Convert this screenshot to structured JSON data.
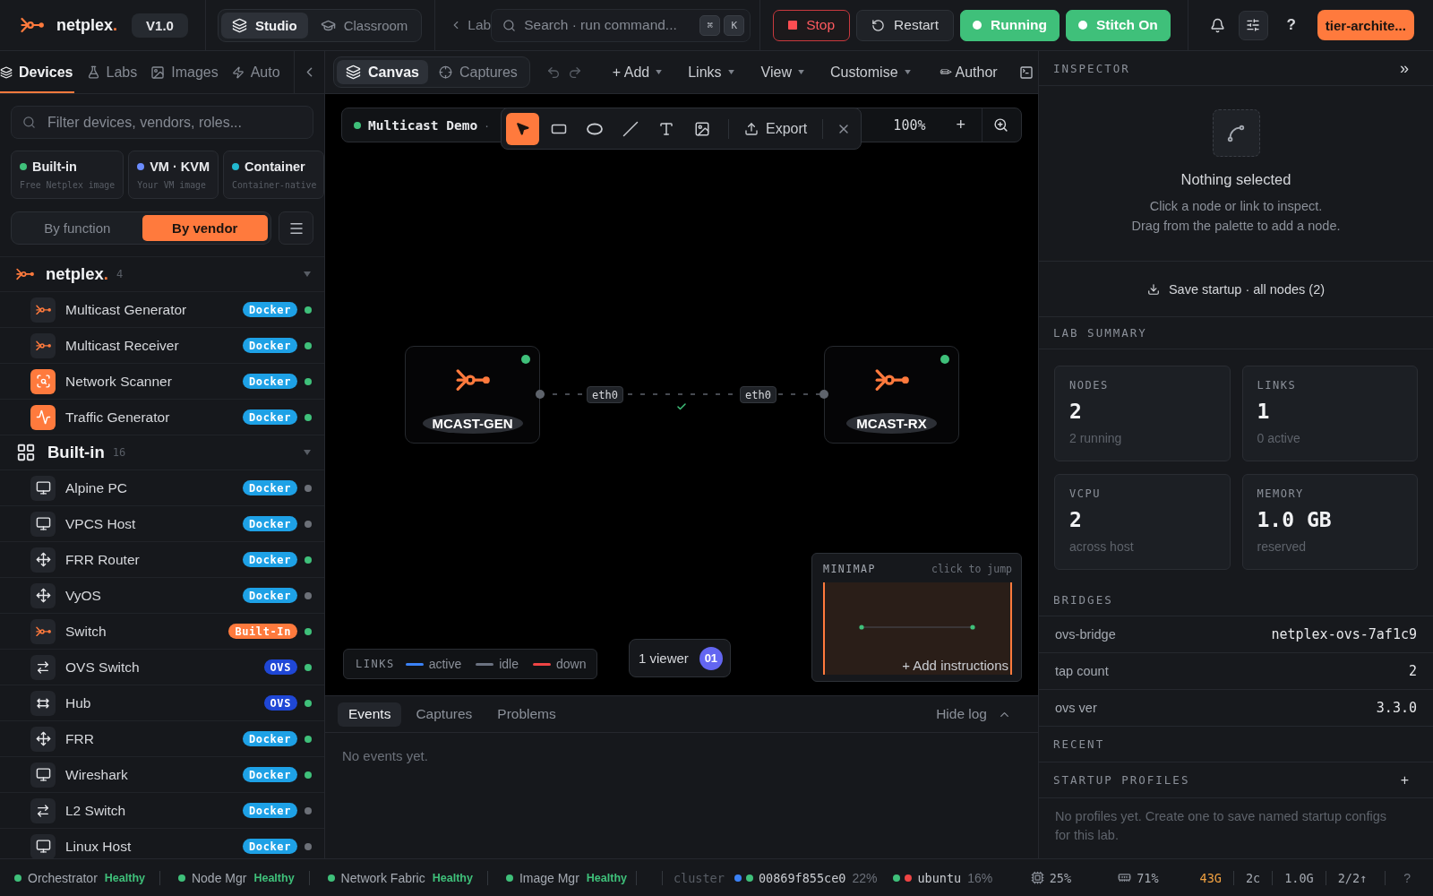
{
  "header": {
    "brand": "netplex.",
    "version": "V1.0",
    "modes": [
      {
        "label": "Studio",
        "kind": "studio",
        "selected": true
      },
      {
        "label": "Classroom",
        "kind": "classroom",
        "selected": false
      }
    ],
    "lab_tab": "Lab",
    "search": {
      "placeholder": "Search · run command...",
      "keys": [
        "⌘",
        "K"
      ]
    },
    "actions": [
      {
        "label": "Stop",
        "kind": "stop"
      },
      {
        "label": "Restart",
        "kind": "restart"
      },
      {
        "label": "Running",
        "kind": "status"
      },
      {
        "label": "Stitch On",
        "kind": "status"
      }
    ],
    "help": "?",
    "user": "tier-archite..."
  },
  "sidebar": {
    "tabs": [
      {
        "label": "Devices",
        "kind": "devices",
        "selected": true
      },
      {
        "label": "Labs",
        "kind": "labs",
        "selected": false
      },
      {
        "label": "Images",
        "kind": "images",
        "selected": false
      },
      {
        "label": "Auto",
        "kind": "auto",
        "selected": false
      }
    ],
    "filter": {
      "placeholder": "Filter devices, vendors, roles..."
    },
    "sources": [
      {
        "title": "Built-in",
        "subtitle": "Free Netplex image",
        "color": "#3fc07a"
      },
      {
        "title": "VM · KVM",
        "subtitle": "Your VM image",
        "color": "#6b8cff"
      },
      {
        "title": "Container",
        "subtitle": "Container-native",
        "color": "#22b8cf"
      }
    ],
    "grouping": [
      {
        "label": "By function",
        "selected": false
      },
      {
        "label": "By vendor",
        "selected": true
      }
    ],
    "groups": [
      {
        "name": "netplex.",
        "kind": "brand",
        "count": "4",
        "expanded": true,
        "items": [
          {
            "name": "Multicast Generator",
            "kind": "multicast",
            "badge": {
              "label": "Docker",
              "color": "#1ea1e6"
            },
            "running": true
          },
          {
            "name": "Multicast Receiver",
            "kind": "multicast",
            "badge": {
              "label": "Docker",
              "color": "#1ea1e6"
            },
            "running": true
          },
          {
            "name": "Network Scanner",
            "kind": "scanner",
            "badge": {
              "label": "Docker",
              "color": "#1ea1e6"
            },
            "running": true
          },
          {
            "name": "Traffic Generator",
            "kind": "traffic",
            "badge": {
              "label": "Docker",
              "color": "#1ea1e6"
            },
            "running": true
          }
        ]
      },
      {
        "name": "Built-in",
        "kind": "catalog",
        "count": "16",
        "expanded": true,
        "items": [
          {
            "name": "Alpine PC",
            "kind": "host",
            "badge": {
              "label": "Docker",
              "color": "#1ea1e6"
            },
            "running": false
          },
          {
            "name": "VPCS Host",
            "kind": "host",
            "badge": {
              "label": "Docker",
              "color": "#1ea1e6"
            },
            "running": false
          },
          {
            "name": "FRR Router",
            "kind": "router",
            "badge": {
              "label": "Docker",
              "color": "#1ea1e6"
            },
            "running": true
          },
          {
            "name": "VyOS",
            "kind": "router",
            "badge": {
              "label": "Docker",
              "color": "#1ea1e6"
            },
            "running": false
          },
          {
            "name": "Switch",
            "kind": "multicast",
            "badge": {
              "label": "Built-In",
              "color": "#ff7a3d"
            },
            "running": true
          },
          {
            "name": "OVS Switch",
            "kind": "switch",
            "badge": {
              "label": "OVS",
              "color": "#1f47d6"
            },
            "running": true
          },
          {
            "name": "Hub",
            "kind": "hub",
            "badge": {
              "label": "OVS",
              "color": "#1f47d6"
            },
            "running": true
          },
          {
            "name": "FRR",
            "kind": "router",
            "badge": {
              "label": "Docker",
              "color": "#1ea1e6"
            },
            "running": true
          },
          {
            "name": "Wireshark",
            "kind": "host",
            "badge": {
              "label": "Docker",
              "color": "#1ea1e6"
            },
            "running": true
          },
          {
            "name": "L2 Switch",
            "kind": "switch",
            "badge": {
              "label": "Docker",
              "color": "#1ea1e6"
            },
            "running": false
          },
          {
            "name": "Linux Host",
            "kind": "host",
            "badge": {
              "label": "Docker",
              "color": "#1ea1e6"
            },
            "running": false
          }
        ]
      }
    ]
  },
  "canvas_toolbar": {
    "views": [
      {
        "label": "Canvas",
        "kind": "canvas",
        "selected": true
      },
      {
        "label": "Captures",
        "kind": "captures",
        "selected": false
      }
    ],
    "menus": [
      {
        "label": "+ Add",
        "dropdown": true
      },
      {
        "label": "Links",
        "dropdown": true
      },
      {
        "label": "View",
        "dropdown": true
      },
      {
        "label": "Customise",
        "dropdown": true
      },
      {
        "label": "✏ Author",
        "dropdown": false
      }
    ]
  },
  "canvas": {
    "lab": {
      "name": "Multicast Demo",
      "separator": "·",
      "running": true
    },
    "tools": [
      {
        "kind": "select",
        "selected": true
      },
      {
        "kind": "rectangle",
        "selected": false
      },
      {
        "kind": "ellipse",
        "selected": false
      },
      {
        "kind": "line",
        "selected": false
      },
      {
        "kind": "text",
        "selected": false
      },
      {
        "kind": "image",
        "selected": false
      }
    ],
    "export": "Export",
    "zoom": "100%",
    "zoom_in": "+",
    "nodes": [
      {
        "label": "MCAST-GEN",
        "running": true
      },
      {
        "label": "MCAST-RX",
        "running": true
      }
    ],
    "link": {
      "ports": [
        "eth0",
        "eth0"
      ],
      "verified": true
    },
    "legend": {
      "title": "LINKS",
      "items": [
        {
          "label": "active",
          "color": "#3b82f6"
        },
        {
          "label": "idle",
          "color": "#6b7280"
        },
        {
          "label": "down",
          "color": "#ef4444"
        }
      ]
    },
    "viewers": {
      "label": "1 viewer",
      "avatar": "01"
    },
    "minimap": {
      "title": "MINIMAP",
      "hint": "click to jump",
      "action": "+ Add instructions"
    }
  },
  "log": {
    "tabs": [
      {
        "label": "Events",
        "selected": true
      },
      {
        "label": "Captures",
        "selected": false
      },
      {
        "label": "Problems",
        "selected": false
      }
    ],
    "toggle": "Hide log",
    "empty": "No events yet."
  },
  "inspector": {
    "title": "INSPECTOR",
    "collapse": "»",
    "empty": {
      "title": "Nothing selected",
      "lines": [
        "Click a node or link to inspect.",
        "Drag from the palette to add a node."
      ]
    },
    "save": "Save startup · all nodes (2)",
    "summary": {
      "title": "LAB SUMMARY",
      "cards": [
        {
          "label": "NODES",
          "value": "2",
          "note": "2 running"
        },
        {
          "label": "LINKS",
          "value": "1",
          "note": "0 active"
        },
        {
          "label": "VCPU",
          "value": "2",
          "note": "across host"
        },
        {
          "label": "MEMORY",
          "value": "1.0 GB",
          "note": "reserved"
        }
      ]
    },
    "bridges": {
      "title": "BRIDGES",
      "rows": [
        {
          "key": "ovs-bridge",
          "value": "netplex-ovs-7af1c9"
        },
        {
          "key": "tap count",
          "value": "2"
        },
        {
          "key": "ovs ver",
          "value": "3.3.0"
        }
      ]
    },
    "recent": {
      "title": "RECENT"
    },
    "profiles": {
      "title": "STARTUP PROFILES",
      "add": "+",
      "empty": "No profiles yet. Create one to save named startup configs for this lab."
    }
  },
  "status_bar": {
    "services": [
      {
        "name": "Orchestrator",
        "status": "Healthy",
        "healthy": true
      },
      {
        "name": "Node Mgr",
        "status": "Healthy",
        "healthy": true
      },
      {
        "name": "Network Fabric",
        "status": "Healthy",
        "healthy": true
      },
      {
        "name": "Image Mgr",
        "status": "Healthy",
        "healthy": true
      }
    ],
    "cluster": {
      "label": "cluster",
      "hosts": [
        {
          "name": "00869f855ce0",
          "load": "22%",
          "dots": [
            {
              "color": "#3b82f6"
            },
            {
              "color": "#3fc07a"
            }
          ]
        },
        {
          "name": "ubuntu",
          "load": "16%",
          "dots": [
            {
              "color": "#3fc07a"
            },
            {
              "color": "#ef4444"
            }
          ]
        }
      ]
    },
    "metrics": [
      {
        "kind": "cpu",
        "value": "25%",
        "warn": false
      },
      {
        "kind": "memory",
        "value": "71%",
        "warn": false
      },
      {
        "kind": "text",
        "value": "43G",
        "warn": true
      },
      {
        "kind": "text",
        "value": "2c",
        "warn": false
      },
      {
        "kind": "text",
        "value": "1.0G",
        "warn": false
      },
      {
        "kind": "text",
        "value": "2/2↑",
        "warn": false
      }
    ],
    "help": "?"
  }
}
